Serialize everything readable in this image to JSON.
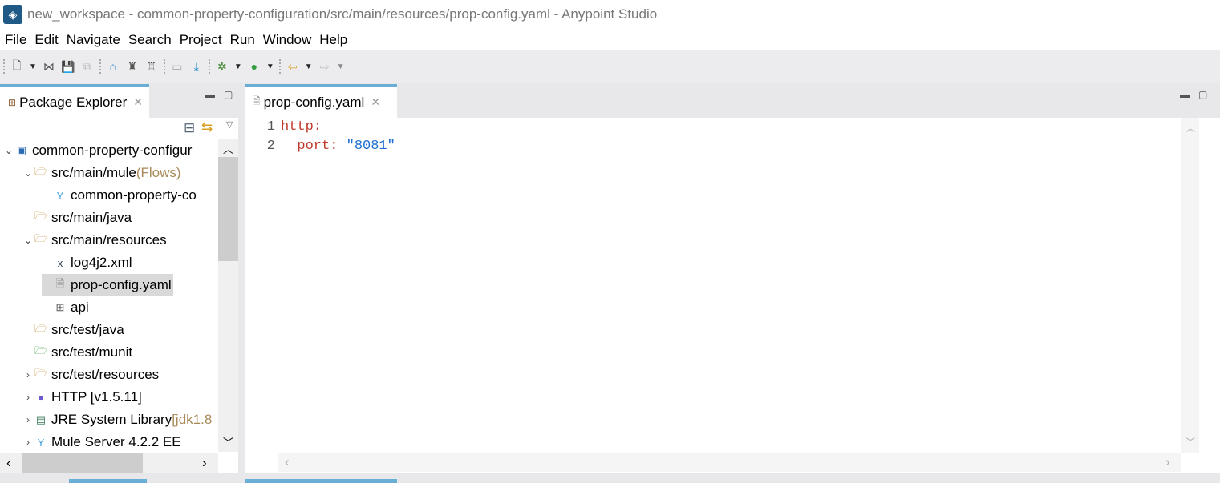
{
  "window": {
    "title": "new_workspace - common-property-configuration/src/main/resources/prop-config.yaml - Anypoint Studio"
  },
  "menu": [
    "File",
    "Edit",
    "Navigate",
    "Search",
    "Project",
    "Run",
    "Window",
    "Help"
  ],
  "explorer": {
    "tab_label": "Package Explorer",
    "items": [
      {
        "label": "common-property-configur",
        "decoration": "",
        "indent": 0,
        "twisty": "open",
        "icon": "project-icon"
      },
      {
        "label": "src/main/mule",
        "decoration": " (Flows)",
        "indent": 1,
        "twisty": "open",
        "icon": "source-folder-icon"
      },
      {
        "label": "common-property-co",
        "decoration": "",
        "indent": 2,
        "twisty": "",
        "icon": "mule-flow-icon"
      },
      {
        "label": "src/main/java",
        "decoration": "",
        "indent": 1,
        "twisty": "",
        "icon": "package-folder-icon"
      },
      {
        "label": "src/main/resources",
        "decoration": "",
        "indent": 1,
        "twisty": "open",
        "icon": "package-folder-icon"
      },
      {
        "label": "log4j2.xml",
        "decoration": "",
        "indent": 2,
        "twisty": "",
        "icon": "xml-file-icon"
      },
      {
        "label": "prop-config.yaml",
        "decoration": "",
        "indent": 2,
        "twisty": "",
        "icon": "raml-file-icon",
        "selected": true
      },
      {
        "label": "api",
        "decoration": "",
        "indent": 2,
        "twisty": "",
        "icon": "package-icon"
      },
      {
        "label": "src/test/java",
        "decoration": "",
        "indent": 1,
        "twisty": "",
        "icon": "package-folder-icon"
      },
      {
        "label": "src/test/munit",
        "decoration": "",
        "indent": 1,
        "twisty": "",
        "icon": "munit-folder-icon"
      },
      {
        "label": "src/test/resources",
        "decoration": "",
        "indent": 1,
        "twisty": "closed",
        "icon": "package-folder-icon"
      },
      {
        "label": "HTTP [v1.5.11]",
        "decoration": "",
        "indent": 1,
        "twisty": "closed",
        "icon": "http-connector-icon"
      },
      {
        "label": "JRE System Library",
        "decoration": " [jdk1.8",
        "indent": 1,
        "twisty": "closed",
        "icon": "library-icon"
      },
      {
        "label": "Mule Server 4.2.2 EE",
        "decoration": "",
        "indent": 1,
        "twisty": "closed",
        "icon": "mule-runtime-icon"
      }
    ]
  },
  "editor": {
    "tab_label": "prop-config.yaml",
    "lines": [
      {
        "n": "1",
        "key": "http:",
        "value": ""
      },
      {
        "n": "2",
        "key": "  port: ",
        "value": "\"8081\""
      }
    ]
  }
}
